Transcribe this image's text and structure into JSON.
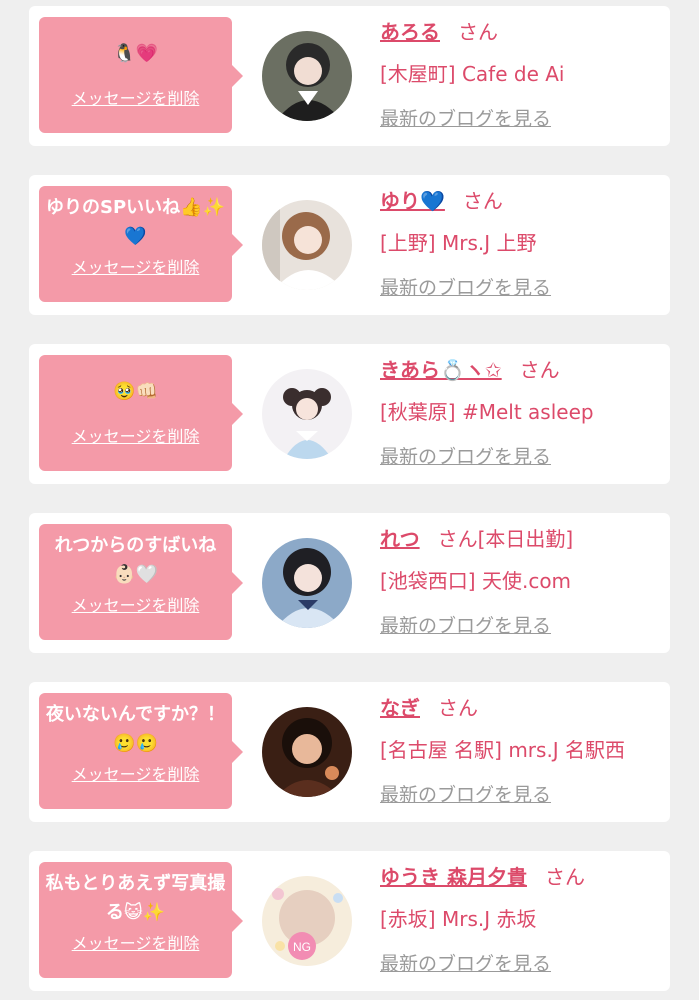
{
  "messages": [
    {
      "message": "🐧💗",
      "delete_label": "メッセージを削除",
      "name": "あろる",
      "honorific": "さん",
      "tag": "",
      "shop": "[木屋町] Cafe de Ai",
      "blog_link": "最新のブログを見る",
      "avatar_icon": "photo-icon"
    },
    {
      "message": "ゆりのSPいいね👍✨💙",
      "delete_label": "メッセージを削除",
      "name": "ゆり💙",
      "honorific": "さん",
      "tag": "",
      "shop": "[上野] Mrs.J 上野",
      "blog_link": "最新のブログを見る",
      "avatar_icon": "photo-icon"
    },
    {
      "message": "🥹👊🏻",
      "delete_label": "メッセージを削除",
      "name": "きあら💍ヽ✩",
      "honorific": "さん",
      "tag": "",
      "shop": "[秋葉原] #Melt asleep",
      "blog_link": "最新のブログを見る",
      "avatar_icon": "photo-icon"
    },
    {
      "message": "れつからのすばいね👶🏻🤍",
      "delete_label": "メッセージを削除",
      "name": "れつ",
      "honorific": "さん",
      "tag": "[本日出勤]",
      "shop": "[池袋西口] 天使.com",
      "blog_link": "最新のブログを見る",
      "avatar_icon": "photo-icon"
    },
    {
      "message": "夜いないんですか？！🥲🥲",
      "delete_label": "メッセージを削除",
      "name": "なぎ",
      "honorific": "さん",
      "tag": "",
      "shop": "[名古屋 名駅] mrs.J 名駅西",
      "blog_link": "最新のブログを見る",
      "avatar_icon": "photo-icon"
    },
    {
      "message": "私もとりあえず写真撮る😺✨",
      "delete_label": "メッセージを削除",
      "name": "ゆうき 森月夕貴",
      "honorific": "さん",
      "tag": "",
      "shop": "[赤坂] Mrs.J 赤坂",
      "blog_link": "最新のブログを見る",
      "avatar_icon": "photo-icon",
      "avatar_badge": "NG"
    }
  ],
  "colors": {
    "background": "#efefef",
    "card": "#ffffff",
    "bubble": "#f49aa8",
    "accent": "#dc4a6a",
    "muted": "#9a9a9a"
  }
}
